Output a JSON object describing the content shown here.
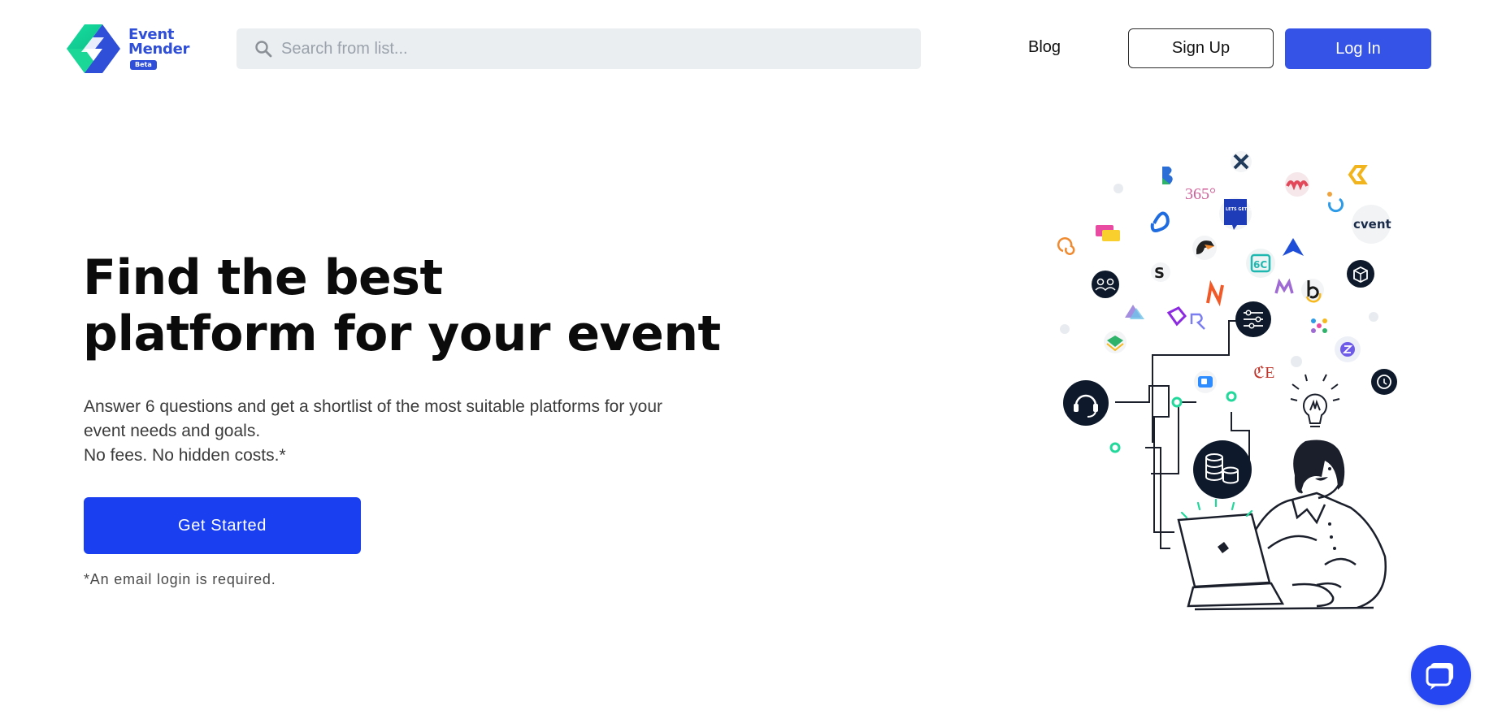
{
  "header": {
    "logo": {
      "line1": "Event",
      "line2": "Mender",
      "badge": "Beta"
    },
    "search": {
      "placeholder": "Search from list...",
      "icon": "magnifier"
    },
    "nav": {
      "blog_label": "Blog",
      "signup_label": "Sign Up",
      "login_label": "Log In"
    }
  },
  "hero": {
    "title_line1": "Find the best",
    "title_line2": "platform for your event",
    "subtitle_line1": "Answer 6 questions and get a shortlist of the most suitable platforms for your",
    "subtitle_line2": "event needs and goals.",
    "subtitle_line3": "No fees. No hidden costs.*",
    "cta_label": "Get Started",
    "footnote": "*An email login is required."
  },
  "illustration": {
    "logo_texts": {
      "cvent": "cvent",
      "n365": "365°",
      "letsgetdigital": "LETS GET DIGI TAL",
      "ce": "ℭE"
    }
  },
  "chat": {
    "icon": "chat-bubble-icon"
  },
  "colors": {
    "brand_blue": "#3553e6",
    "cta_blue": "#1a3ff0",
    "brand_green": "#22d89a",
    "search_bg": "#eaeef1"
  }
}
